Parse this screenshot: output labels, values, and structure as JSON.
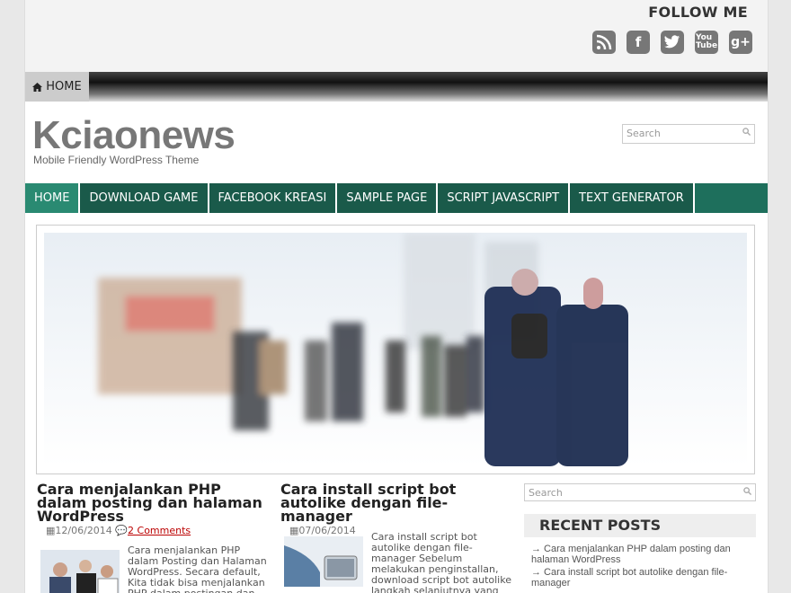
{
  "header": {
    "follow_label": "FOLLOW ME",
    "social_icons": [
      "rss-icon",
      "facebook-icon",
      "twitter-icon",
      "youtube-icon",
      "googleplus-icon"
    ]
  },
  "topnav": {
    "home_label": "HOME",
    "home_icon": "house-icon"
  },
  "site": {
    "title": "Kciaonews",
    "tagline": "Mobile Friendly WordPress Theme"
  },
  "search": {
    "placeholder": "Search"
  },
  "mainnav": {
    "items": [
      "HOME",
      "DOWNLOAD GAME",
      "FACEBOOK KREASI",
      "SAMPLE PAGE",
      "SCRIPT JAVASCRIPT",
      "TEXT GENERATOR"
    ]
  },
  "posts": [
    {
      "title": "Cara menjalankan PHP dalam posting dan halaman WordPress",
      "date": "12/06/2014",
      "comments": "2 Comments",
      "excerpt": "Cara menjalankan PHP dalam Posting dan Halaman WordPress. Secara default, Kita tidak bisa menjalankan PHP dalam postingan dan"
    },
    {
      "title": "Cara install script bot autolike dengan file-manager",
      "date": "07/06/2014",
      "excerpt": "Cara install script bot autolike dengan file-manager Sebelum melakukan penginstallan, download script bot autolike langkah selanjutnya yang diperlukan adalah sebuah"
    }
  ],
  "sidebar": {
    "recent_title": "RECENT POSTS",
    "recent": [
      "→ Cara menjalankan PHP dalam posting dan halaman WordPress",
      "→ Cara install script bot autolike dengan file-manager"
    ]
  },
  "colors": {
    "nav": "#1a5a4a",
    "nav_active": "#2a8a72"
  }
}
